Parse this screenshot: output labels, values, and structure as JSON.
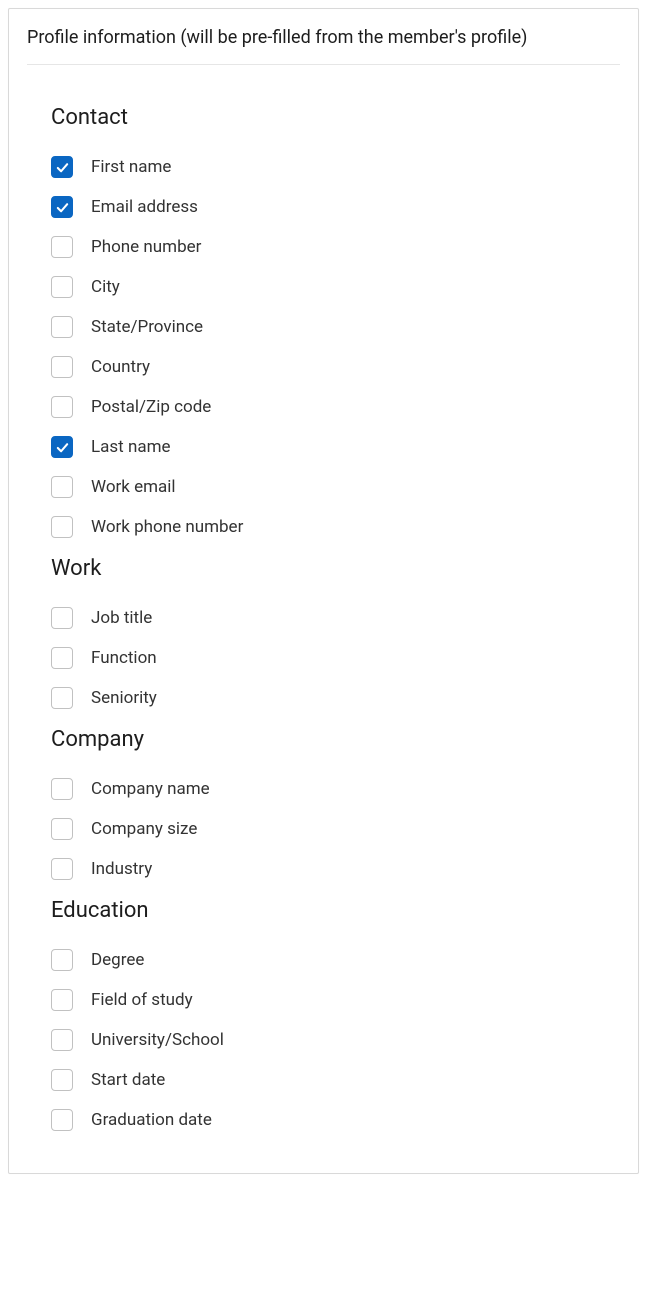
{
  "header": {
    "title": "Profile information (will be pre-filled from the member's profile)"
  },
  "sections": {
    "contact": {
      "title": "Contact",
      "fields": {
        "first_name": {
          "label": "First name",
          "checked": true
        },
        "email": {
          "label": "Email address",
          "checked": true
        },
        "phone": {
          "label": "Phone number",
          "checked": false
        },
        "city": {
          "label": "City",
          "checked": false
        },
        "state": {
          "label": "State/Province",
          "checked": false
        },
        "country": {
          "label": "Country",
          "checked": false
        },
        "postal": {
          "label": "Postal/Zip code",
          "checked": false
        },
        "last_name": {
          "label": "Last name",
          "checked": true
        },
        "work_email": {
          "label": "Work email",
          "checked": false
        },
        "work_phone": {
          "label": "Work phone number",
          "checked": false
        }
      }
    },
    "work": {
      "title": "Work",
      "fields": {
        "job_title": {
          "label": "Job title",
          "checked": false
        },
        "function": {
          "label": "Function",
          "checked": false
        },
        "seniority": {
          "label": "Seniority",
          "checked": false
        }
      }
    },
    "company": {
      "title": "Company",
      "fields": {
        "company_name": {
          "label": "Company name",
          "checked": false
        },
        "company_size": {
          "label": "Company size",
          "checked": false
        },
        "industry": {
          "label": "Industry",
          "checked": false
        }
      }
    },
    "education": {
      "title": "Education",
      "fields": {
        "degree": {
          "label": "Degree",
          "checked": false
        },
        "field_of_study": {
          "label": "Field of study",
          "checked": false
        },
        "university": {
          "label": "University/School",
          "checked": false
        },
        "start_date": {
          "label": "Start date",
          "checked": false
        },
        "graduation_date": {
          "label": "Graduation date",
          "checked": false
        }
      }
    }
  }
}
